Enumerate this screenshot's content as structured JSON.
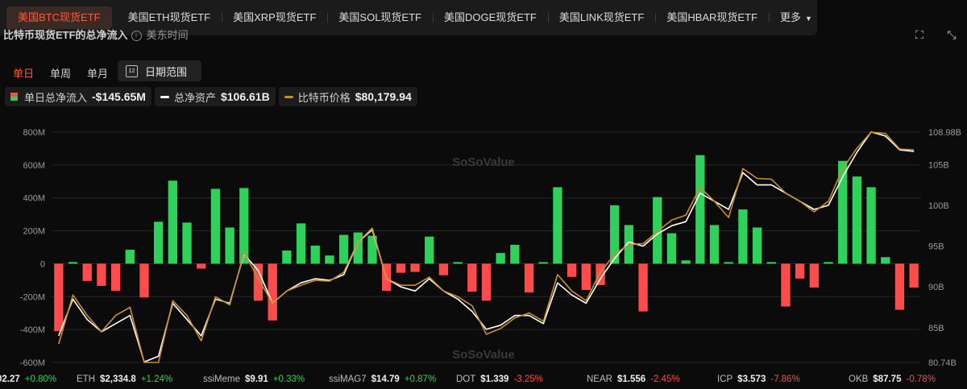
{
  "tabs": [
    {
      "label": "美国BTC现货ETF",
      "active": true
    },
    {
      "label": "美国ETH现货ETF"
    },
    {
      "label": "美国XRP现货ETF"
    },
    {
      "label": "美国SOL现货ETF"
    },
    {
      "label": "美国DOGE现货ETF"
    },
    {
      "label": "美国LINK现货ETF"
    },
    {
      "label": "美国HBAR现货ETF"
    },
    {
      "label": "更多"
    }
  ],
  "header": {
    "title": "比特币现货ETF的总净流入",
    "timezone": "美东时间"
  },
  "toolbar": {
    "icons": [
      "fullscreen-icon",
      "collapse-icon"
    ]
  },
  "period": {
    "options": [
      "单日",
      "单周",
      "单月"
    ],
    "active": "单日"
  },
  "date_range": {
    "label": "日期范围",
    "icon": "calendar-icon"
  },
  "legend": {
    "daily_flow": {
      "label": "单日总净流入",
      "value": "-$145.65M"
    },
    "total_assets": {
      "label": "总净资产",
      "value": "$106.61B",
      "color": "#ffffff"
    },
    "btc_price": {
      "label": "比特币价格",
      "value": "$80,179.94",
      "color": "#c8902c"
    }
  },
  "watermark": "SoSoValue",
  "colors": {
    "positive": "#2fd15a",
    "negative": "#ff4b4b",
    "accent": "#ff5a37"
  },
  "chart_data": {
    "type": "bar",
    "left_axis": {
      "ticks": [
        "800M",
        "600M",
        "400M",
        "200M",
        "0",
        "-200M",
        "-400M",
        "-600M"
      ],
      "ylim": [
        -600,
        800
      ],
      "unit": "M"
    },
    "right_axis": {
      "ticks": [
        "108.98B",
        "105B",
        "100B",
        "95B",
        "90B",
        "85B",
        "80.74B"
      ],
      "ylim": [
        80.74,
        108.98
      ]
    },
    "series": [
      {
        "name": "单日总净流入",
        "unit": "M",
        "values": [
          -410,
          10,
          -105,
          -135,
          -165,
          85,
          -205,
          255,
          505,
          250,
          -30,
          455,
          220,
          460,
          -225,
          -345,
          80,
          245,
          110,
          50,
          175,
          190,
          170,
          -165,
          -55,
          -50,
          165,
          -70,
          0,
          -170,
          -225,
          65,
          115,
          -175,
          0,
          465,
          -80,
          -160,
          -130,
          355,
          235,
          -290,
          405,
          185,
          20,
          660,
          235,
          10,
          330,
          220,
          10,
          -260,
          -90,
          -145,
          10,
          625,
          530,
          465,
          40,
          -280,
          -145
        ]
      },
      {
        "name": "总净资产",
        "unit": "B",
        "values": [
          84,
          88.5,
          86,
          84.5,
          85.5,
          86.5,
          80.8,
          81.5,
          88,
          86,
          84,
          88.5,
          88,
          94,
          92,
          88,
          89.5,
          90.5,
          91,
          90.8,
          91.5,
          95.5,
          97,
          91,
          90,
          89.5,
          91,
          89.5,
          88.5,
          87,
          84.8,
          85.3,
          86.5,
          86.5,
          85.5,
          90.5,
          89,
          88,
          91,
          93.5,
          95.5,
          95,
          96.5,
          97.5,
          98,
          101.5,
          100.5,
          99.5,
          104,
          102.5,
          102.5,
          101.5,
          100.5,
          99.5,
          100,
          103.5,
          106.5,
          109,
          108.5,
          106.8,
          106.61
        ]
      },
      {
        "name": "比特币价格",
        "unit": "B",
        "values": [
          83,
          89,
          86.5,
          84.5,
          86.5,
          87.5,
          80.74,
          80.74,
          88.3,
          86.5,
          83.4,
          88.8,
          87.8,
          94.2,
          91,
          88,
          89.5,
          90.2,
          90.8,
          90.7,
          91.8,
          95.5,
          97.2,
          91,
          90.2,
          90.2,
          91.2,
          89.5,
          88.8,
          87.7,
          84.2,
          84.9,
          86.2,
          86.8,
          85.8,
          91.5,
          89.5,
          88.3,
          91.8,
          94,
          95.2,
          95.3,
          96.8,
          98.2,
          98.8,
          102.2,
          100.5,
          98.5,
          104.5,
          103.3,
          103.2,
          101.5,
          100.5,
          99.2,
          100.5,
          104.5,
          107,
          108.98,
          108.8,
          106.9,
          106.8
        ]
      }
    ]
  },
  "ticker": [
    {
      "name": "",
      "price": "02.27",
      "change": "+0.80%",
      "dir": "up"
    },
    {
      "name": "ETH",
      "price": "$2,334.8",
      "change": "+1.24%",
      "dir": "up"
    },
    {
      "name": "ssiMeme",
      "price": "$9.91",
      "change": "+0.33%",
      "dir": "up"
    },
    {
      "name": "ssiMAG7",
      "price": "$14.79",
      "change": "+0.87%",
      "dir": "up"
    },
    {
      "name": "DOT",
      "price": "$1.339",
      "change": "-3.25%",
      "dir": "down"
    },
    {
      "name": "NEAR",
      "price": "$1.556",
      "change": "-2.45%",
      "dir": "down"
    },
    {
      "name": "ICP",
      "price": "$3.573",
      "change": "-7.86%",
      "dir": "down"
    },
    {
      "name": "OKB",
      "price": "$87.75",
      "change": "-0.78%",
      "dir": "down"
    }
  ]
}
